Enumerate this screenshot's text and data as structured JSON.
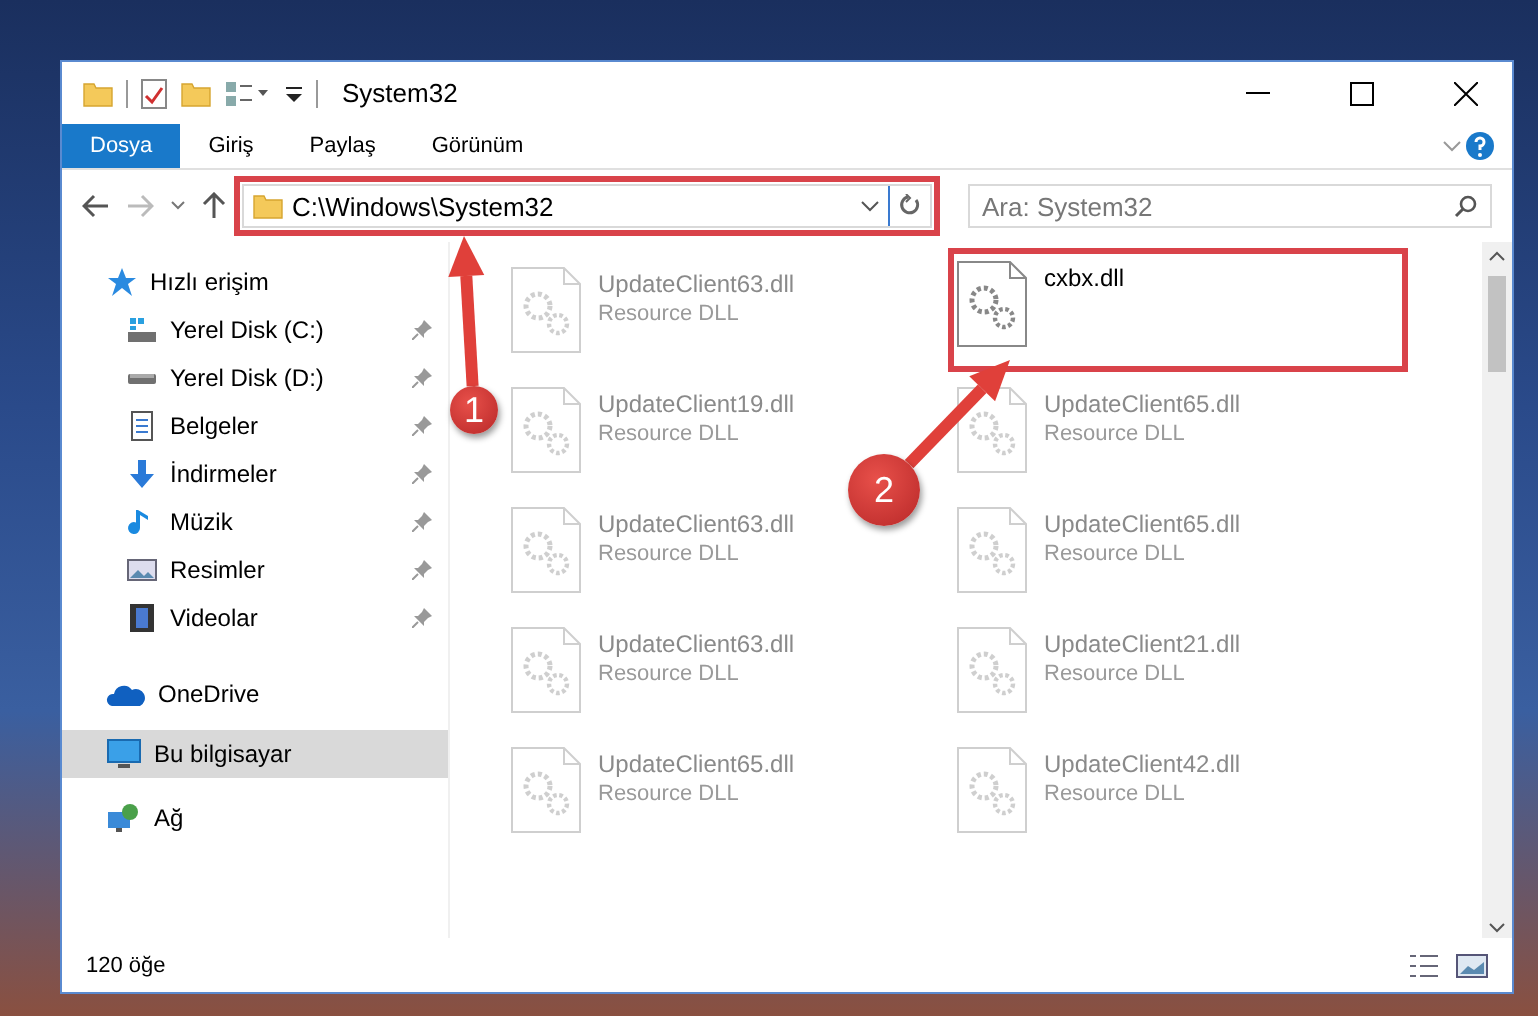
{
  "window": {
    "title": "System32"
  },
  "ribbon_tabs": [
    {
      "label": "Dosya",
      "selected": true
    },
    {
      "label": "Giriş",
      "selected": false
    },
    {
      "label": "Paylaş",
      "selected": false
    },
    {
      "label": "Görünüm",
      "selected": false
    }
  ],
  "address_bar": {
    "value": "C:\\Windows\\System32",
    "highlighted": true
  },
  "search": {
    "placeholder": "Ara: System32"
  },
  "sidebar": {
    "items": [
      {
        "label": "Hızlı erişim",
        "kind": "star",
        "selected": false,
        "children": [
          {
            "label": "Yerel Disk (C:)",
            "kind": "drive-c",
            "selected": false,
            "pinned": true
          },
          {
            "label": "Yerel Disk (D:)",
            "kind": "drive",
            "selected": false,
            "pinned": true
          },
          {
            "label": "Belgeler",
            "kind": "document",
            "selected": false,
            "pinned": true
          },
          {
            "label": "İndirmeler",
            "kind": "download",
            "selected": false,
            "pinned": true
          },
          {
            "label": "Müzik",
            "kind": "music",
            "selected": false,
            "pinned": true
          },
          {
            "label": "Resimler",
            "kind": "picture",
            "selected": false,
            "pinned": true
          },
          {
            "label": "Videolar",
            "kind": "video",
            "selected": false,
            "pinned": true
          }
        ]
      },
      {
        "label": "OneDrive",
        "kind": "cloud",
        "selected": false
      },
      {
        "label": "Bu bilgisayar",
        "kind": "computer",
        "selected": true
      },
      {
        "label": "Ağ",
        "kind": "network",
        "selected": false
      }
    ]
  },
  "files": [
    {
      "name": "UpdateClient63.dll",
      "type": "Resource DLL",
      "faded": true,
      "highlighted": false
    },
    {
      "name": "cxbx.dll",
      "faded": false,
      "highlighted": true
    },
    {
      "name": "UpdateClient19.dll",
      "type": "Resource DLL",
      "faded": true,
      "highlighted": false
    },
    {
      "name": "UpdateClient65.dll",
      "type": "Resource DLL",
      "faded": true,
      "highlighted": false
    },
    {
      "name": "UpdateClient63.dll",
      "type": "Resource DLL",
      "faded": true,
      "highlighted": false
    },
    {
      "name": "UpdateClient65.dll",
      "type": "Resource DLL",
      "faded": true,
      "highlighted": false
    },
    {
      "name": "UpdateClient63.dll",
      "type": "Resource DLL",
      "faded": true,
      "highlighted": false
    },
    {
      "name": "UpdateClient21.dll",
      "type": "Resource DLL",
      "faded": true,
      "highlighted": false
    },
    {
      "name": "UpdateClient65.dll",
      "type": "Resource DLL",
      "faded": true,
      "highlighted": false
    },
    {
      "name": "UpdateClient42.dll",
      "type": "Resource DLL",
      "faded": true,
      "highlighted": false
    }
  ],
  "status_bar": {
    "count": "120 öğe"
  },
  "annotations": [
    {
      "number": "1"
    },
    {
      "number": "2"
    }
  ]
}
